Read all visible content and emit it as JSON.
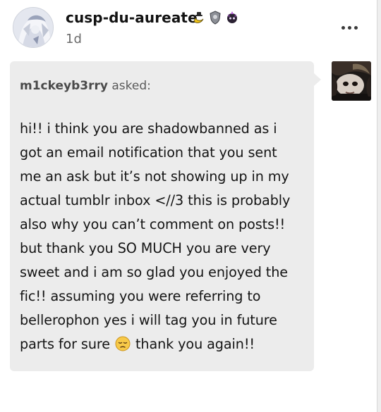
{
  "post": {
    "blog_name": "cusp-du-aureate",
    "timestamp": "1d",
    "badges": [
      "banana-badge-icon",
      "shield-badge-icon",
      "purple-creature-badge-icon"
    ]
  },
  "ask": {
    "asker_name": "m1ckeyb3rry",
    "asked_suffix": " asked:",
    "text_before_emoji": "hi!! i think you are shadowbanned as i\ngot an email notification that you sent\nme an ask but it’s not showing up in my\nactual tumblr inbox <//3 this is probably\nalso why you can’t comment on posts!!\nbut thank you SO MUCH you are very\nsweet and i am so glad you enjoyed the\nfic!! assuming you were referring to\nbellerophon yes i will tag you in future\nparts for sure ",
    "emoji": "pensive-face-emoji",
    "text_after_emoji": " thank you again!!"
  },
  "colors": {
    "bubble": "#ececec",
    "text": "#141414",
    "muted": "#6b6b6b"
  }
}
